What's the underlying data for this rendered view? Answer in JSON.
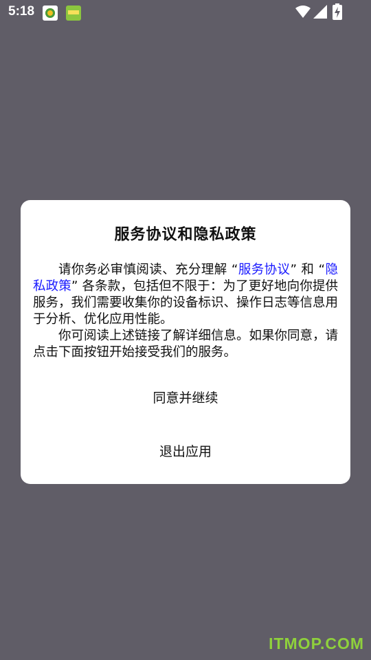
{
  "status_bar": {
    "time": "5:18",
    "icons": [
      "app-notification-icon",
      "app-notification-icon-2",
      "wifi-icon",
      "signal-icon",
      "battery-charging-icon"
    ]
  },
  "dialog": {
    "title": "服务协议和隐私政策",
    "body": {
      "p1_prefix": "请你务必审慎阅读、充分理解 “",
      "link_service": "服务协议",
      "p1_mid": "” 和 “",
      "link_privacy": "隐私政策",
      "p1_suffix": "” 各条款，包括但不限于：为了更好地向你提供服务，我们需要收集你的设备标识、操作日志等信息用于分析、优化应用性能。",
      "p2": "你可阅读上述链接了解详细信息。如果你同意，请点击下面按钮开始接受我们的服务。"
    },
    "agree_label": "同意并继续",
    "exit_label": "退出应用"
  },
  "watermark": "ITMOP.COM",
  "colors": {
    "overlay": "#605d67",
    "link": "#1a1aff",
    "watermark": "#8fd13c"
  }
}
